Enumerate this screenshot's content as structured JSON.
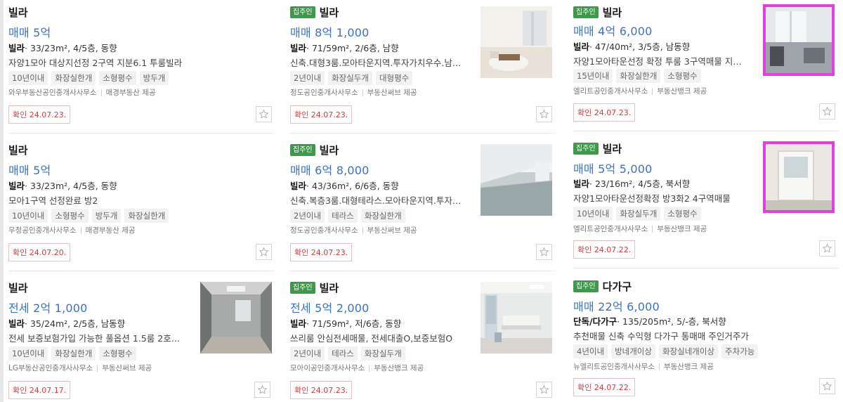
{
  "listings": [
    {
      "badge": "",
      "type": "빌라",
      "price": "매매 5억",
      "spec_label": "빌라",
      "spec": "· 33/23m², 4/5층, 동향",
      "desc": "자양1모아 대상지선정 2구역 지분6.1 투룸빌라",
      "tags": [
        "10년이내",
        "화장실한개",
        "소형평수",
        "방두개"
      ],
      "agent": "와우부동산공인중개사사무소",
      "provider": "매경부동산 제공",
      "confirm": "확인 24.07.23.",
      "thumb": ""
    },
    {
      "badge": "집주인",
      "type": "빌라",
      "price": "매매 8억 1,000",
      "spec_label": "빌라",
      "spec": "· 71/59m², 2/6층, 남향",
      "desc": "신축.대형3룸.모아타운지역.투자가치우수.남…",
      "tags": [
        "2년이내",
        "화장실두개",
        "대형평수"
      ],
      "agent": "정도공인중개사사무소",
      "provider": "부동산써브 제공",
      "confirm": "확인 24.07.23.",
      "thumb": "living-room-photo"
    },
    {
      "badge": "집주인",
      "type": "빌라",
      "price": "매매 4억 6,000",
      "spec_label": "빌라",
      "spec": "· 47/40m², 3/5층, 남동향",
      "desc": "자양1모아타운선정 확정 투룸 3구역매물 지…",
      "tags": [
        "15년이내",
        "화장실한개",
        "소형평수"
      ],
      "agent": "엘리트공인중개사사무소",
      "provider": "부동산뱅크 제공",
      "confirm": "확인 24.07.23.",
      "thumb": "room-photo-magenta"
    },
    {
      "badge": "",
      "type": "빌라",
      "price": "매매 5억",
      "spec_label": "빌라",
      "spec": "· 33/23m², 4/5층, 동향",
      "desc": "모아1구역 선정완료 방2",
      "tags": [
        "10년이내",
        "소형평수",
        "방두개",
        "화장실한개"
      ],
      "agent": "우정공인중개사사무소",
      "provider": "매경부동산 제공",
      "confirm": "확인 24.07.20.",
      "thumb": ""
    },
    {
      "badge": "집주인",
      "type": "빌라",
      "price": "매매 6억 8,000",
      "spec_label": "빌라",
      "spec": "· 43/36m², 6/6층, 동향",
      "desc": "신축.복층3룸.대형테라스.모아타운지역.투자…",
      "tags": [
        "2년이내",
        "테라스",
        "화장실한개"
      ],
      "agent": "정도공인중개사사무소",
      "provider": "부동산써브 제공",
      "confirm": "확인 24.07.23.",
      "thumb": "terrace-photo"
    },
    {
      "badge": "집주인",
      "type": "빌라",
      "price": "매매 5억 5,000",
      "spec_label": "빌라",
      "spec": "· 23/16m², 4/5층, 북서향",
      "desc": "자양1모아타운선정확정 방3화2 4구역매물",
      "tags": [
        "10년이내",
        "화장실두개",
        "소형평수"
      ],
      "agent": "엘리트공인중개사사무소",
      "provider": "부동산뱅크 제공",
      "confirm": "확인 24.07.22.",
      "thumb": "window-photo-magenta"
    },
    {
      "badge": "",
      "type": "빌라",
      "price": "전세 2억 1,000",
      "spec_label": "빌라",
      "spec": "· 35/24m², 2/5층, 남동향",
      "desc": "전세 보증보험가입 가능한 풀옵션 1.5룸 2호…",
      "tags": [
        "10년이내",
        "화장실한개",
        "소형평수"
      ],
      "agent": "LG부동산공인중개사사무소",
      "provider": "부동산써브 제공",
      "confirm": "확인 24.07.17.",
      "thumb": "empty-room-photo"
    },
    {
      "badge": "집주인",
      "type": "빌라",
      "price": "전세 5억 2,000",
      "spec_label": "빌라",
      "spec": "· 71/59m², 저/6층, 동향",
      "desc": "쓰리룸 안심전세매물, 전세대출O,보증보험O",
      "tags": [
        "2년이내",
        "테라스",
        "화장실두개"
      ],
      "agent": "모아이공인중개사사무소",
      "provider": "부동산뱅크 제공",
      "confirm": "확인 24.07.23.",
      "thumb": "bright-room-photo"
    },
    {
      "badge": "집주인",
      "type": "다가구",
      "price": "매매 22억 6,000",
      "spec_label": "단독/다가구",
      "spec": "· 135/205m², 5/-층, 북서향",
      "desc": "추천매물 신축 수익형 다가구 통매매 주인거주가",
      "tags": [
        "4년이내",
        "방네개이상",
        "화장실네개이상",
        "주차가능"
      ],
      "agent": "뉴엘리트공인중개사사무소",
      "provider": "부동산뱅크 제공",
      "confirm": "확인 24.07.22.",
      "thumb": ""
    }
  ],
  "colors": {
    "price": "#3972c6",
    "badge": "#3d9a4a",
    "confirm": "#d63b3b",
    "highlight": "#e040e0"
  }
}
